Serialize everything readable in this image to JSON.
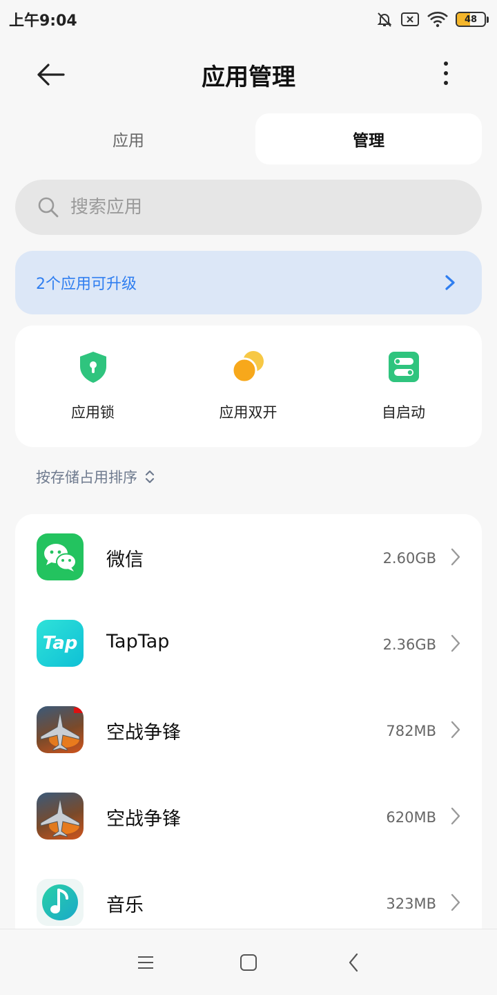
{
  "status_bar": {
    "time": "上午9:04",
    "battery_level": "48",
    "battery_fraction": 0.48,
    "icons": [
      "bell-off-icon",
      "sim-x-icon",
      "wifi-icon",
      "battery-icon"
    ]
  },
  "header": {
    "title": "应用管理",
    "icons": [
      "back-arrow-icon",
      "more-vertical-icon"
    ]
  },
  "segment": {
    "tabs": [
      {
        "label": "应用",
        "selected": false
      },
      {
        "label": "管理",
        "selected": true
      }
    ]
  },
  "search": {
    "placeholder": "搜索应用",
    "value": ""
  },
  "upgrade_banner": {
    "text": "2个应用可升级"
  },
  "tools": [
    {
      "label": "应用锁",
      "icon": "shield-lock-icon",
      "color": "#2fc47e"
    },
    {
      "label": "应用双开",
      "icon": "dual-circles-icon",
      "color": "#f7a81b"
    },
    {
      "label": "自启动",
      "icon": "toggle-switch-icon",
      "color": "#2fc47e"
    }
  ],
  "sort": {
    "label": "按存储占用排序",
    "icon": "sort-arrows-icon"
  },
  "apps": [
    {
      "name": "微信",
      "size": "2.60GB",
      "icon": "wechat-icon"
    },
    {
      "name": "TapTap",
      "size": "2.36GB",
      "icon": "taptap-icon",
      "icon_text": "Tap"
    },
    {
      "name": "空战争锋",
      "size": "782MB",
      "icon": "jet-game-icon"
    },
    {
      "name": "空战争锋",
      "size": "620MB",
      "icon": "jet-game-icon"
    },
    {
      "name": "音乐",
      "size": "323MB",
      "icon": "music-icon"
    }
  ],
  "nav_bar": {
    "icons": [
      "menu-icon",
      "home-square-icon",
      "back-chevron-icon"
    ]
  },
  "colors": {
    "accent_blue": "#2f7ef0",
    "banner_bg": "#dce7f7",
    "wechat_green": "#23c35f",
    "taptap_cyan": "#17d1d6",
    "battery_yellow": "#f5b62a"
  }
}
